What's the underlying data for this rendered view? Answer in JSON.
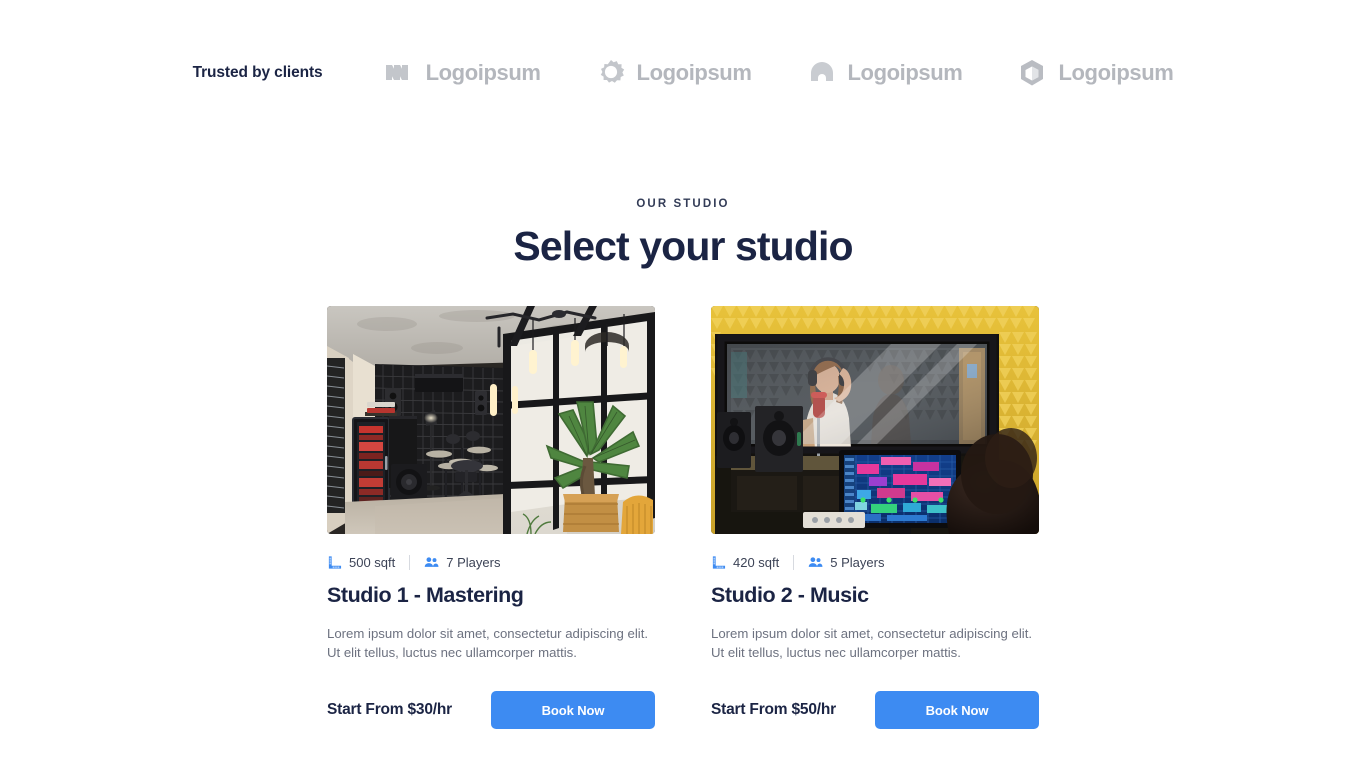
{
  "trusted": {
    "label": "Trusted by clients",
    "logos": [
      {
        "icon": "zigzag-chevron-logo-icon",
        "text": "Logoipsum"
      },
      {
        "icon": "gear-ring-logo-icon",
        "text": "Logoipsum"
      },
      {
        "icon": "arch-dome-logo-icon",
        "text": "Logoipsum"
      },
      {
        "icon": "hexagon-cube-logo-icon",
        "text": "Logoipsum"
      }
    ]
  },
  "section": {
    "eyebrow": "OUR STUDIO",
    "title": "Select your studio"
  },
  "colors": {
    "heading": "#1b2444",
    "accent": "#3d8bf2",
    "body_text": "#6d7280",
    "logo_gray": "#b4b7bd",
    "meta_icon": "#3d8bf2"
  },
  "cards": [
    {
      "photo_alt": "studio-1-interior-photo",
      "area_icon": "ruler-corner-icon",
      "area": "500 sqft",
      "players_icon": "people-group-icon",
      "players": "7 Players",
      "title": "Studio 1 - Mastering",
      "description": "Lorem ipsum dolor sit amet, consectetur adipiscing elit. Ut elit tellus, luctus nec ullamcorper mattis.",
      "price": "Start From $30/hr",
      "button": "Book Now"
    },
    {
      "photo_alt": "studio-2-recording-booth-photo",
      "area_icon": "ruler-corner-icon",
      "area": "420 sqft",
      "players_icon": "people-group-icon",
      "players": "5 Players",
      "title": "Studio 2 - Music",
      "description": "Lorem ipsum dolor sit amet, consectetur adipiscing elit. Ut elit tellus, luctus nec ullamcorper mattis.",
      "price": "Start From $50/hr",
      "button": "Book Now"
    }
  ]
}
